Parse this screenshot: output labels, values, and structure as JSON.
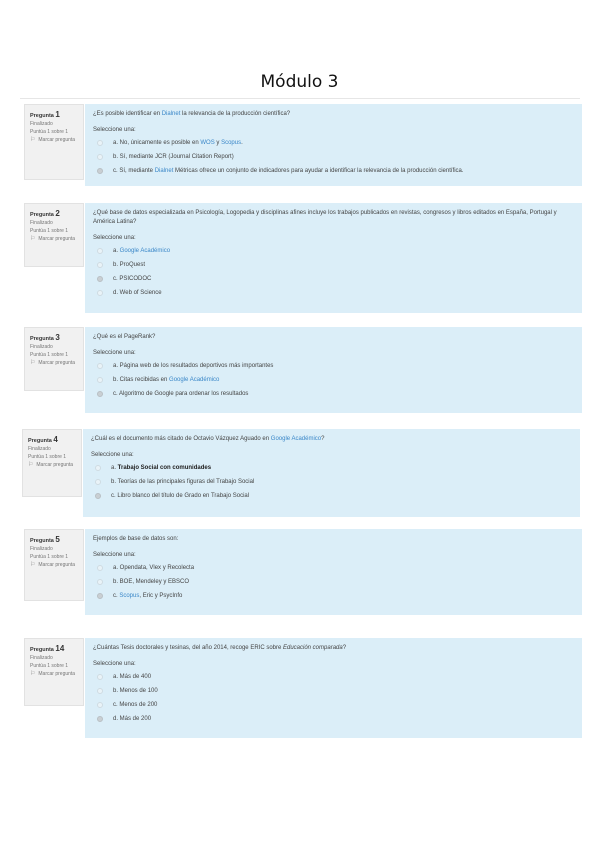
{
  "title": "Módulo 3",
  "questions": [
    {
      "number": "1",
      "label": "Pregunta",
      "status": "Finalizado",
      "score": "Puntúa 1 sobre 1",
      "flag": "Marcar pregunta",
      "text": [
        {
          "t": "¿Es posible identificar en "
        },
        {
          "t": "Dialnet",
          "link": true
        },
        {
          "t": " la relevancia de la producción científica?"
        }
      ],
      "prompt": "Seleccione una:",
      "options": [
        {
          "parts": [
            {
              "t": "a. No, únicamente es posible en "
            },
            {
              "t": "WOS",
              "link": true
            },
            {
              "t": " y "
            },
            {
              "t": "Scopus",
              "link": true
            },
            {
              "t": "."
            }
          ],
          "selected": false
        },
        {
          "parts": [
            {
              "t": "b. Sí, mediante JCR (Journal Citation Report)"
            }
          ],
          "selected": false
        },
        {
          "parts": [
            {
              "t": "c. Sí, mediante "
            },
            {
              "t": "Dialnet",
              "link": true
            },
            {
              "t": " Métricas ofrece un conjunto de indicadores para ayudar a identificar la relevancia de la producción científica."
            }
          ],
          "selected": true
        }
      ]
    },
    {
      "number": "2",
      "label": "Pregunta",
      "status": "Finalizado",
      "score": "Puntúa 1 sobre 1",
      "flag": "Marcar pregunta",
      "text": [
        {
          "t": "¿Qué base de datos especializada en Psicología, Logopedia y disciplinas afines incluye los trabajos publicados en revistas, congresos y libros editados en España, Portugal y América Latina?"
        }
      ],
      "prompt": "Seleccione una:",
      "options": [
        {
          "parts": [
            {
              "t": "a. "
            },
            {
              "t": "Google Académico",
              "link": true
            }
          ],
          "selected": false
        },
        {
          "parts": [
            {
              "t": "b. ProQuest"
            }
          ],
          "selected": false
        },
        {
          "parts": [
            {
              "t": "c. PSICODOC"
            }
          ],
          "selected": true
        },
        {
          "parts": [
            {
              "t": "d. Web of Science"
            }
          ],
          "selected": false
        }
      ]
    },
    {
      "number": "3",
      "label": "Pregunta",
      "status": "Finalizado",
      "score": "Puntúa 1 sobre 1",
      "flag": "Marcar pregunta",
      "text": [
        {
          "t": "¿Qué es el PageRank?"
        }
      ],
      "prompt": "Seleccione una:",
      "options": [
        {
          "parts": [
            {
              "t": "a. Página web de los resultados deportivos más importantes"
            }
          ],
          "selected": false
        },
        {
          "parts": [
            {
              "t": "b. Citas recibidas en "
            },
            {
              "t": "Google Académico",
              "link": true
            }
          ],
          "selected": false
        },
        {
          "parts": [
            {
              "t": "c. Algoritmo de Google para ordenar los resultados"
            }
          ],
          "selected": true
        }
      ]
    },
    {
      "number": "4",
      "label": "Pregunta",
      "status": "Finalizado",
      "score": "Puntúa 1 sobre 1",
      "flag": "Marcar pregunta",
      "text": [
        {
          "t": "¿Cuál es el documento más citado de Octavio Vázquez Aguado en "
        },
        {
          "t": "Google Académico",
          "link": true
        },
        {
          "t": "?"
        }
      ],
      "prompt": "Seleccione una:",
      "options": [
        {
          "parts": [
            {
              "t": "a. "
            },
            {
              "t": "Trabajo Social con comunidades",
              "bold": true
            }
          ],
          "selected": false
        },
        {
          "parts": [
            {
              "t": "b. Teorías de las principales figuras del Trabajo Social"
            }
          ],
          "selected": false
        },
        {
          "parts": [
            {
              "t": "c. Libro blanco del título de Grado en Trabajo Social"
            }
          ],
          "selected": true
        }
      ]
    },
    {
      "number": "5",
      "label": "Pregunta",
      "status": "Finalizado",
      "score": "Puntúa 1 sobre 1",
      "flag": "Marcar pregunta",
      "text": [
        {
          "t": "Ejemplos de base de datos son:"
        }
      ],
      "prompt": "Seleccione una:",
      "options": [
        {
          "parts": [
            {
              "t": "a. Opendata, Vlex y Recolecta"
            }
          ],
          "selected": false
        },
        {
          "parts": [
            {
              "t": "b. BOE, Mendeley y EBSCO"
            }
          ],
          "selected": false
        },
        {
          "parts": [
            {
              "t": "c. "
            },
            {
              "t": "Scopus",
              "link": true
            },
            {
              "t": ", Eric y PsycInfo"
            }
          ],
          "selected": true
        }
      ]
    },
    {
      "number": "14",
      "label": "Pregunta",
      "status": "Finalizado",
      "score": "Puntúa 1 sobre 1",
      "flag": "Marcar pregunta",
      "text": [
        {
          "t": "¿Cuántas Tesis doctorales y tesinas, del año 2014, recoge ERIC sobre "
        },
        {
          "t": "Educación comparada",
          "italic": true
        },
        {
          "t": "?"
        }
      ],
      "prompt": "Seleccione una:",
      "options": [
        {
          "parts": [
            {
              "t": "a. Más de 400"
            }
          ],
          "selected": false
        },
        {
          "parts": [
            {
              "t": "b. Menos de 100"
            }
          ],
          "selected": false
        },
        {
          "parts": [
            {
              "t": "c. Menos de 200"
            }
          ],
          "selected": false
        },
        {
          "parts": [
            {
              "t": "d. Más de 200"
            }
          ],
          "selected": true
        }
      ]
    }
  ]
}
